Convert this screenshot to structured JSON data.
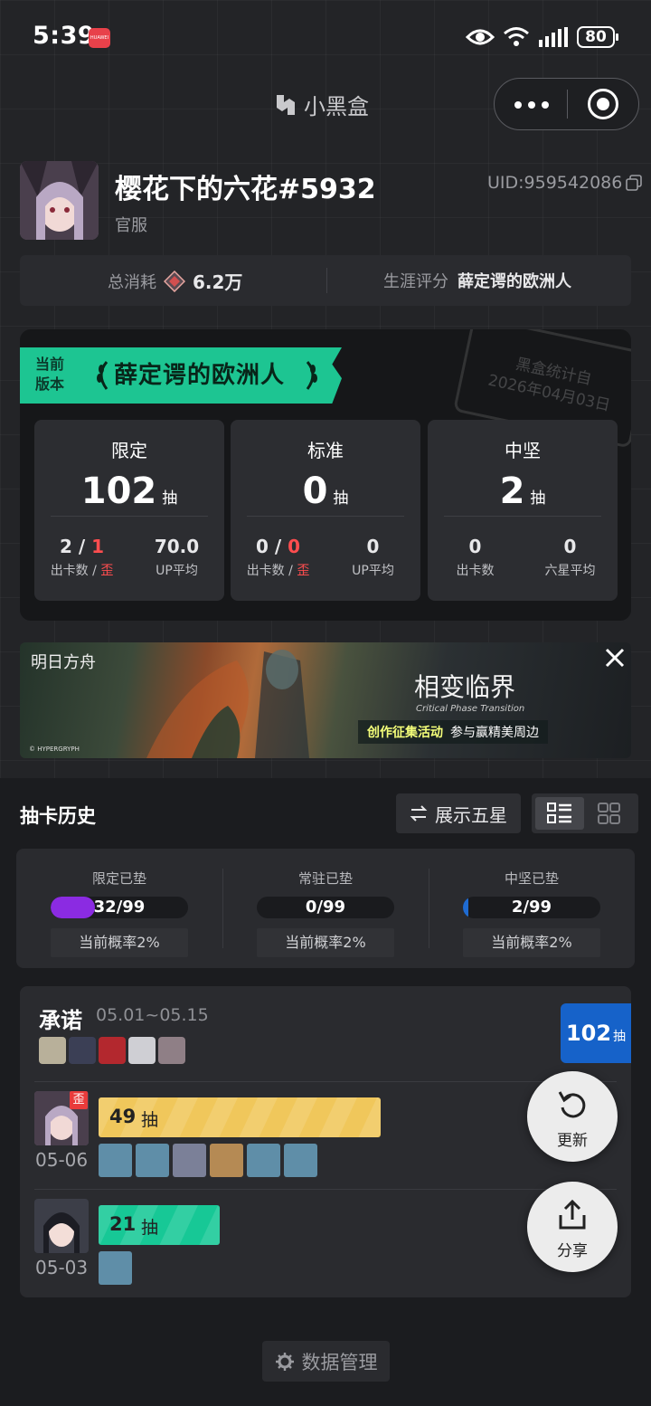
{
  "status_bar": {
    "time": "5:39",
    "badge": "HUAWEI",
    "battery": "80"
  },
  "app": {
    "title": "小黑盒"
  },
  "profile": {
    "nickname": "樱花下的六花#5932",
    "server": "官服",
    "uid": "UID:959542086",
    "total_cost_label": "总消耗",
    "total_cost_value": "6.2万",
    "career_label": "生涯评分",
    "career_value": "薛定谔的欧洲人"
  },
  "version_card": {
    "current_label_1": "当前",
    "current_label_2": "版本",
    "title": "薛定谔的欧洲人",
    "stamp_line1": "黑盒统计自",
    "stamp_line2": "2026年04月03日",
    "boxes": [
      {
        "name": "限定",
        "count": "102",
        "unit": "抽",
        "left_value_a": "2",
        "left_value_sep": " / ",
        "left_value_b": "1",
        "left_label_a": "出卡数 / ",
        "left_label_b": "歪",
        "right_value": "70.0",
        "right_label": "UP平均"
      },
      {
        "name": "标准",
        "count": "0",
        "unit": "抽",
        "left_value_a": "0",
        "left_value_sep": " / ",
        "left_value_b": "0",
        "left_label_a": "出卡数 / ",
        "left_label_b": "歪",
        "right_value": "0",
        "right_label": "UP平均"
      },
      {
        "name": "中坚",
        "count": "2",
        "unit": "抽",
        "left_value_a": "0",
        "left_value_sep": "",
        "left_value_b": "",
        "left_label_a": "出卡数",
        "left_label_b": "",
        "right_value": "0",
        "right_label": "六星平均"
      }
    ]
  },
  "ad_banner": {
    "logo": "明日方舟",
    "title": "相变临界",
    "subtitle": "Critical Phase Transition",
    "activity": "创作征集活动",
    "activity_note": "参与赢精美周边",
    "copyright": "© HYPERGRYPH"
  },
  "history": {
    "title": "抽卡历史",
    "show_five_star": "展示五星",
    "pity": [
      {
        "label": "限定已垫",
        "value": "32/99",
        "fill": 0.323,
        "color": "#8b2be2",
        "rate": "当前概率2%"
      },
      {
        "label": "常驻已垫",
        "value": "0/99",
        "fill": 0.0,
        "color": "#1f6bd1",
        "rate": "当前概率2%"
      },
      {
        "label": "中坚已垫",
        "value": "2/99",
        "fill": 0.02,
        "color": "#1f6bd1",
        "rate": "当前概率2%"
      }
    ],
    "banner_pool": {
      "name": "承诺",
      "dates": "05.01~05.15",
      "total": "102",
      "total_unit": "抽",
      "pulls": [
        {
          "count": "49",
          "unit": "抽",
          "date": "05-06",
          "tag": "歪",
          "color": "#f0c75b",
          "progress": 0.49
        },
        {
          "count": "21",
          "unit": "抽",
          "date": "05-03",
          "tag": "",
          "color": "#17c896",
          "progress": 0.21
        }
      ]
    },
    "refresh": "更新",
    "share": "分享"
  },
  "footer": {
    "manage": "数据管理"
  },
  "icons": [
    "eye-icon",
    "wifi-icon",
    "signal-icon",
    "battery-icon",
    "more-dots-icon",
    "record-icon",
    "copy-icon",
    "diamond-currency-icon",
    "laurel-icon",
    "close-icon",
    "swap-icon",
    "list-view-icon",
    "grid-view-icon",
    "refresh-icon",
    "share-icon",
    "gear-icon"
  ]
}
